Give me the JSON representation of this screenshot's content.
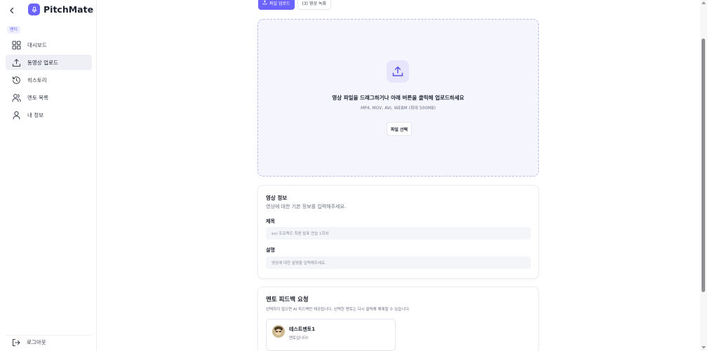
{
  "sidebar": {
    "brand": "PitchMate",
    "section_badge": "멘티",
    "items": [
      {
        "label": "대시보드",
        "icon": "dashboard-grid-icon"
      },
      {
        "label": "동영상 업로드",
        "icon": "upload-icon",
        "active": true
      },
      {
        "label": "히스토리",
        "icon": "history-icon"
      },
      {
        "label": "멘토 목록",
        "icon": "users-icon"
      },
      {
        "label": "내 정보",
        "icon": "user-icon"
      }
    ],
    "logout_label": "로그아웃"
  },
  "tabs": [
    {
      "label": "파일 업로드",
      "active": true
    },
    {
      "label": "(3) 영상 녹화",
      "active": false
    }
  ],
  "dropzone": {
    "title": "영상 파일을 드래그하거나 아래 버튼을 클릭해 업로드하세요",
    "subtitle": "MP4, MOV, AVI, WEBM (최대 500MB)",
    "button": "파일 선택"
  },
  "video_info": {
    "title": "영상 정보",
    "subtitle": "영상에 대한 기본 정보를 입력해주세요.",
    "title_label": "제목",
    "title_placeholder": "ex) 프로젝트 최종 발표 연습 1회차",
    "desc_label": "설명",
    "desc_placeholder": "영상에 대한 설명을 입력해주세요."
  },
  "mentor_request": {
    "title": "멘토 피드백 요청",
    "subtitle": "선택하지 않으면 AI 피드백만 제공됩니다. 선택한 멘토는 다시 클릭해 해제할 수 있습니다.",
    "mentors": [
      {
        "name": "테스트멘토1",
        "intro": "멘토입니다!"
      }
    ]
  },
  "colors": {
    "accent": "#6c63ff",
    "dropzone_bg": "#f5f5fd",
    "active_nav_bg": "#eef0f6"
  }
}
